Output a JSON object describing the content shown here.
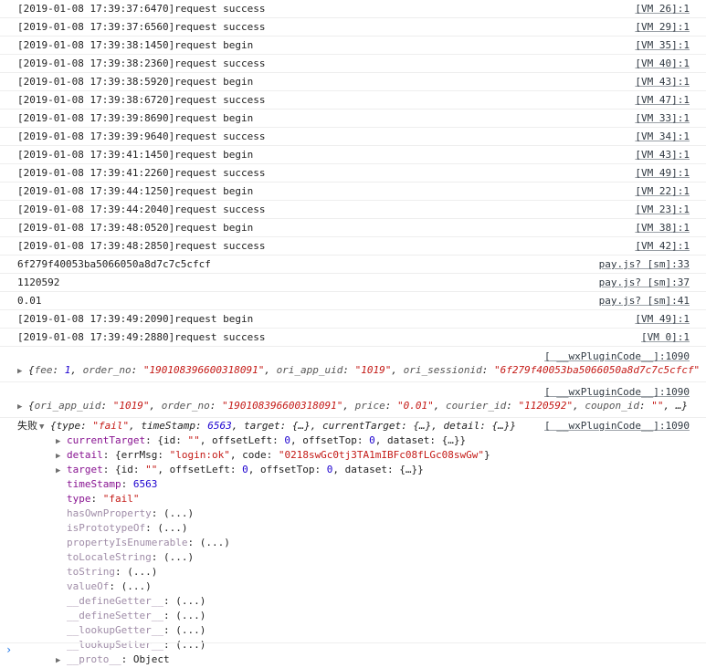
{
  "logs": [
    {
      "text": "[2019-01-08 17:39:37:6470]request success",
      "source": "[VM 26]:1"
    },
    {
      "text": "[2019-01-08 17:39:37:6560]request success",
      "source": "[VM 29]:1"
    },
    {
      "text": "[2019-01-08 17:39:38:1450]request begin",
      "source": "[VM 35]:1"
    },
    {
      "text": "[2019-01-08 17:39:38:2360]request success",
      "source": "[VM 40]:1"
    },
    {
      "text": "[2019-01-08 17:39:38:5920]request begin",
      "source": "[VM 43]:1"
    },
    {
      "text": "[2019-01-08 17:39:38:6720]request success",
      "source": "[VM 47]:1"
    },
    {
      "text": "[2019-01-08 17:39:39:8690]request begin",
      "source": "[VM 33]:1"
    },
    {
      "text": "[2019-01-08 17:39:39:9640]request success",
      "source": "[VM 34]:1"
    },
    {
      "text": "[2019-01-08 17:39:41:1450]request begin",
      "source": "[VM 43]:1"
    },
    {
      "text": "[2019-01-08 17:39:41:2260]request success",
      "source": "[VM 49]:1"
    },
    {
      "text": "[2019-01-08 17:39:44:1250]request begin",
      "source": "[VM 22]:1"
    },
    {
      "text": "[2019-01-08 17:39:44:2040]request success",
      "source": "[VM 23]:1"
    },
    {
      "text": "[2019-01-08 17:39:48:0520]request begin",
      "source": "[VM 38]:1"
    },
    {
      "text": "[2019-01-08 17:39:48:2850]request success",
      "source": "[VM 42]:1"
    },
    {
      "text": "6f279f40053ba5066050a8d7c7c5cfcf",
      "source": "pay.js? [sm]:33"
    },
    {
      "text": "1120592",
      "source": "pay.js? [sm]:37"
    },
    {
      "text": "0.01",
      "source": "pay.js? [sm]:41"
    },
    {
      "text": "[2019-01-08 17:39:49:2090]request begin",
      "source": "[VM 49]:1"
    },
    {
      "text": "[2019-01-08 17:39:49:2880]request success",
      "source": "[VM 0]:1"
    }
  ],
  "obj1": {
    "source": "[ __wxPluginCode__]:1090",
    "open": "{",
    "k1": "fee",
    "v1": "1",
    "k2": "order_no",
    "v2": "\"190108396600318091\"",
    "k3": "ori_app_uid",
    "v3": "\"1019\"",
    "k4": "ori_sessionid",
    "v4": "\"6f279f40053ba5066050a8d7c7c5cfcf\"",
    "tail": ","
  },
  "obj2": {
    "source": "[ __wxPluginCode__]:1090",
    "open": "{",
    "k1": "ori_app_uid",
    "v1": "\"1019\"",
    "k2": "order_no",
    "v2": "\"190108396600318091\"",
    "k3": "price",
    "v3": "\"0.01\"",
    "k4": "courier_id",
    "v4": "\"1120592\"",
    "k5": "coupon_id",
    "v5": "\"\"",
    "tail": ", …}"
  },
  "fail": {
    "label": "失败",
    "source": "[ __wxPluginCode__]:1090",
    "summary_pre": "{type: ",
    "summary_type": "\"fail\"",
    "summary_mid": ", timeStamp: ",
    "summary_ts": "6563",
    "summary_post": ", target: {…}, currentTarget: {…}, detail: {…}}",
    "currentTarget_key": "currentTarget",
    "currentTarget_pre": ": {id: ",
    "currentTarget_id": "\"\"",
    "currentTarget_mid": ", offsetLeft: ",
    "currentTarget_left": "0",
    "currentTarget_mid2": ", offsetTop: ",
    "currentTarget_top": "0",
    "currentTarget_post": ", dataset: {…}}",
    "detail_key": "detail",
    "detail_pre": ": {errMsg: ",
    "detail_msg": "\"login:ok\"",
    "detail_mid": ", code: ",
    "detail_code": "\"0218swGc0tj3TA1mIBFc08fLGc08swGw\"",
    "detail_post": "}",
    "target_key": "target",
    "target_pre": ": {id: ",
    "target_id": "\"\"",
    "target_mid": ", offsetLeft: ",
    "target_left": "0",
    "target_mid2": ", offsetTop: ",
    "target_top": "0",
    "target_post": ", dataset: {…}}",
    "ts_key": "timeStamp",
    "ts_val": "6563",
    "type_key": "type",
    "type_val": "\"fail\"",
    "methods": [
      {
        "name": "hasOwnProperty",
        "val": ": (...)"
      },
      {
        "name": "isPrototypeOf",
        "val": ": (...)"
      },
      {
        "name": "propertyIsEnumerable",
        "val": ": (...)"
      },
      {
        "name": "toLocaleString",
        "val": ": (...)"
      },
      {
        "name": "toString",
        "val": ": (...)"
      },
      {
        "name": "valueOf",
        "val": ": (...)"
      },
      {
        "name": "__defineGetter__",
        "val": ": (...)"
      },
      {
        "name": "__defineSetter__",
        "val": ": (...)"
      },
      {
        "name": "__lookupGetter__",
        "val": ": (...)"
      },
      {
        "name": "__lookupSetter__",
        "val": ": (...)"
      }
    ],
    "proto_key": "__proto__",
    "proto_val": ": Object"
  },
  "prompt_symbol": "›"
}
